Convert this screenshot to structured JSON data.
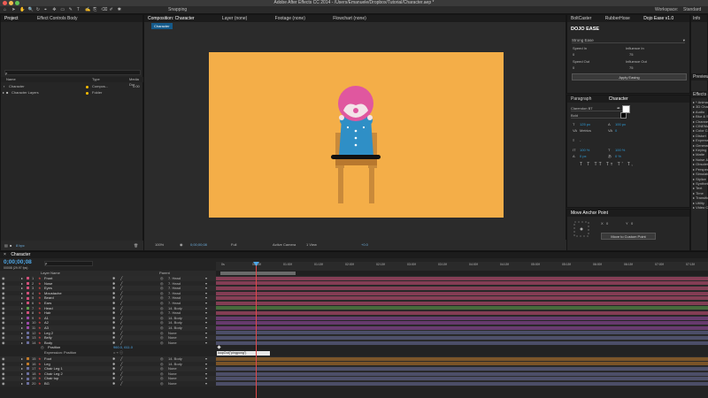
{
  "window": {
    "title": "Adobe After Effects CC 2014 - /Users/Emanuele/Dropbox/Tutorial/Character.aep *"
  },
  "toolbar": {
    "snapping": "Snapping",
    "workspace_label": "Workspace:",
    "workspace_value": "Standard"
  },
  "project": {
    "tab": "Project",
    "tab2": "Effect Controls Body",
    "search_placeholder": "ρ",
    "columns": [
      "Name",
      "Type",
      "Media Dur"
    ],
    "items": [
      {
        "name": "Character",
        "type": "Compos...",
        "dur": "0:00"
      },
      {
        "name": "Character Layers",
        "type": "Folder",
        "dur": ""
      }
    ],
    "footer": "8 bpc",
    "label_yellow": "#ffbf00"
  },
  "viewer": {
    "tabs": [
      "Composition: Character",
      "Layer (none)",
      "Footage (none)",
      "Flowchart (none)"
    ],
    "comp_tab": "Character",
    "footer": {
      "zoom": "100%",
      "time": "0;00;00;08",
      "resolution": "Full",
      "camera": "Active Camera",
      "views": "1 View",
      "exposure": "+0.0"
    },
    "bg": "#f4ae48",
    "frame": "#000000",
    "pink": "#e0579f",
    "blue": "#2f8fc6",
    "wood": "#c98a3a"
  },
  "right": {
    "tabs": [
      "BoltCaster",
      "RubberHose",
      "Dojo Ease v1.0"
    ],
    "logo": "DOJO EASE",
    "section": "Strong Ease",
    "labels": [
      "Speed In",
      "Influence In",
      "Speed Out",
      "Influence Out"
    ],
    "values": [
      "0",
      "75",
      "0",
      "75"
    ],
    "apply": "Apply Easing",
    "char_tabs": [
      "Paragraph",
      "Character"
    ],
    "font": "Clarendon BT",
    "style": "Bold",
    "size": "125 px",
    "leading": "100 px",
    "tracking": "0",
    "scale_v": "100 %",
    "scale_h": "100 %",
    "baseline": "0 px",
    "tsume": "0 %",
    "kerning": "Metrics",
    "anchor_title": "Move Anchor Point",
    "anchor_x": "0",
    "anchor_y": "0",
    "anchor_btn": "Move to Custom Point"
  },
  "far": {
    "info": "Info",
    "preview": "Preview",
    "effects": "Effects & Presets",
    "effects_items": [
      "* Animation Presets",
      "3D Channel",
      "Audio",
      "Blur & Sharpen",
      "Channel",
      "CINEMA 4D",
      "Color Correction",
      "Distort",
      "Expression Controls",
      "Generate",
      "Keying",
      "Matte",
      "Noise & Grain",
      "Obsolete",
      "Perspective",
      "Simulation",
      "Stylize",
      "Synthetic Aperture",
      "Text",
      "Time",
      "Transition",
      "Utility",
      "Video Copilot"
    ]
  },
  "timeline": {
    "tab": "Character",
    "timecode": "0;00;00;08",
    "fps": "00008 (29.97 fps)",
    "search_placeholder": "ρ",
    "col_name": "Layer Name",
    "col_parent": "Parent",
    "layers": [
      {
        "n": "1",
        "name": "Front",
        "parent": "7. Head",
        "color": "#d0507a"
      },
      {
        "n": "2",
        "name": "Nose",
        "parent": "7. Head",
        "color": "#d0507a"
      },
      {
        "n": "3",
        "name": "Eyes",
        "parent": "7. Head",
        "color": "#d0507a"
      },
      {
        "n": "4",
        "name": "Moustache",
        "parent": "7. Head",
        "color": "#d0507a"
      },
      {
        "n": "5",
        "name": "Beard",
        "parent": "7. Head",
        "color": "#d0507a"
      },
      {
        "n": "6",
        "name": "Ears",
        "parent": "7. Head",
        "color": "#d0507a"
      },
      {
        "n": "7",
        "name": "Head",
        "parent": "14. Body",
        "color": "#5ea04b"
      },
      {
        "n": "8",
        "name": "Hair",
        "parent": "7. Head",
        "color": "#d0507a"
      },
      {
        "n": "9",
        "name": "A1",
        "parent": "14. Body",
        "color": "#9b4aa8"
      },
      {
        "n": "10",
        "name": "A2",
        "parent": "14. Body",
        "color": "#9b4aa8"
      },
      {
        "n": "11",
        "name": "A3",
        "parent": "14. Body",
        "color": "#9b4aa8"
      },
      {
        "n": "12",
        "name": "Leg 2",
        "parent": "None",
        "color": "#6b6f9e"
      },
      {
        "n": "13",
        "name": "Belly",
        "parent": "None",
        "color": "#6b6f9e"
      },
      {
        "n": "14",
        "name": "Body",
        "parent": "None",
        "color": "#6b6f9e"
      }
    ],
    "prop_position": "Position",
    "prop_position_value": "960.0, 611.0",
    "expr_label": "Expression: Position",
    "expr_text": "loopOut(\"pingpong\")",
    "layers2": [
      {
        "n": "15",
        "name": "Foot",
        "parent": "14. Body",
        "color": "#c07a2a"
      },
      {
        "n": "16",
        "name": "Leg",
        "parent": "14. Body",
        "color": "#c07a2a"
      },
      {
        "n": "17",
        "name": "Chair Leg 1",
        "parent": "None",
        "color": "#6b6f9e"
      },
      {
        "n": "18",
        "name": "Chair Leg 2",
        "parent": "None",
        "color": "#6b6f9e"
      },
      {
        "n": "19",
        "name": "Chair top",
        "parent": "None",
        "color": "#6b6f9e"
      },
      {
        "n": "20",
        "name": "BG",
        "parent": "None",
        "color": "#6b6f9e"
      }
    ],
    "ruler": [
      "0s",
      "00:15f",
      "01:00f",
      "01:15f",
      "02:00f",
      "02:15f",
      "03:00f",
      "03:15f",
      "04:00f",
      "04:15f",
      "05:00f",
      "05:15f",
      "06:00f",
      "06:15f",
      "07:00f",
      "07:15f"
    ]
  }
}
